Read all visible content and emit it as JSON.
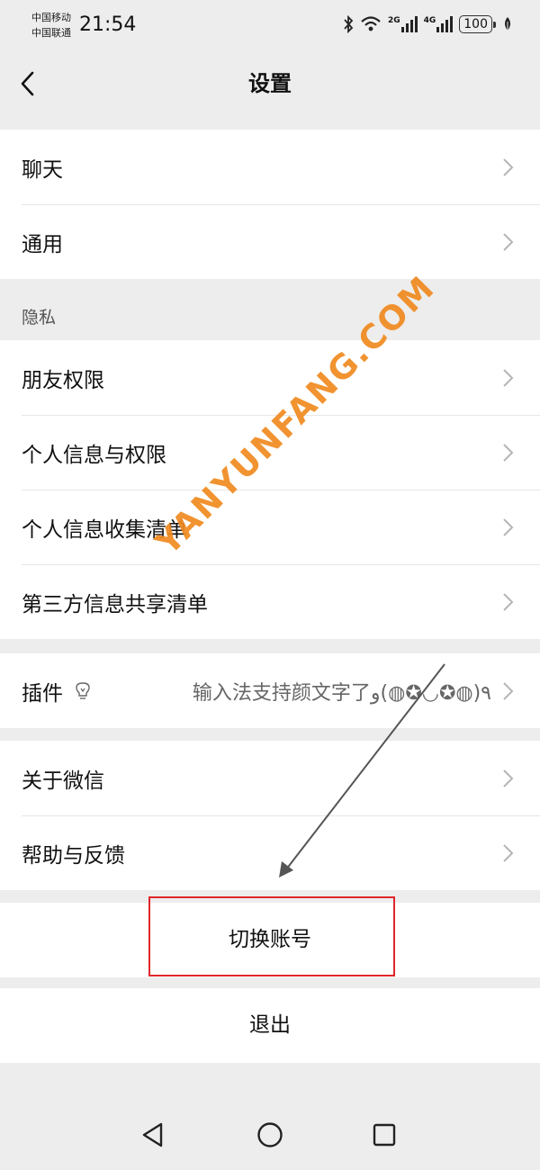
{
  "status_bar": {
    "carrier_1": "中国移动",
    "carrier_2": "中国联通",
    "time": "21:54",
    "signal_1_label": "2G",
    "signal_2_label": "4G",
    "battery": "100",
    "icons": [
      "bluetooth-icon",
      "wifi-icon",
      "signal-icon",
      "signal-icon",
      "battery-icon",
      "leaf-icon"
    ]
  },
  "header": {
    "title": "设置"
  },
  "group_general": {
    "items": [
      {
        "label": "聊天"
      },
      {
        "label": "通用"
      }
    ]
  },
  "group_privacy": {
    "header": "隐私",
    "items": [
      {
        "label": "朋友权限"
      },
      {
        "label": "个人信息与权限"
      },
      {
        "label": "个人信息收集清单"
      },
      {
        "label": "第三方信息共享清单"
      }
    ]
  },
  "group_plugins": {
    "label": "插件",
    "subtitle": "输入法支持颜文字了٩(◍✪◡✪◍)و"
  },
  "group_about": {
    "items": [
      {
        "label": "关于微信"
      },
      {
        "label": "帮助与反馈"
      }
    ]
  },
  "actions": {
    "switch_account": "切换账号",
    "logout": "退出"
  },
  "watermark": "YANYUNFANG.COM",
  "colors": {
    "background": "#ededed",
    "highlight": "#e0262b",
    "watermark": "#f08a1f",
    "arrow": "#555555"
  }
}
